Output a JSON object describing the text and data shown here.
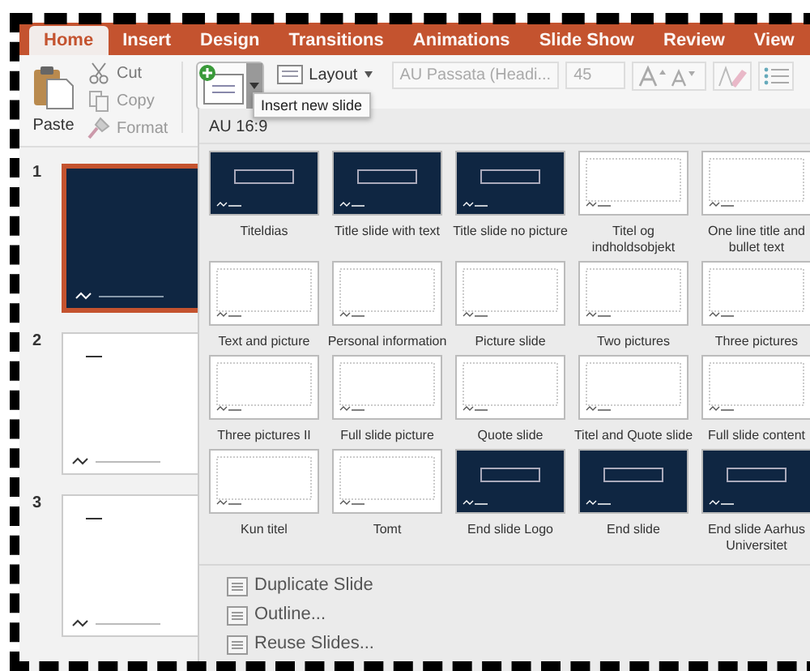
{
  "ribbon": {
    "tabs": [
      {
        "label": "Home",
        "selected": true
      },
      {
        "label": "Insert",
        "selected": false
      },
      {
        "label": "Design",
        "selected": false
      },
      {
        "label": "Transitions",
        "selected": false
      },
      {
        "label": "Animations",
        "selected": false
      },
      {
        "label": "Slide Show",
        "selected": false
      },
      {
        "label": "Review",
        "selected": false
      },
      {
        "label": "View",
        "selected": false
      }
    ],
    "paste": "Paste",
    "cut": "Cut",
    "copy": "Copy",
    "format": "Format",
    "layout": "Layout",
    "font": "AU Passata (Headi...",
    "size": "45"
  },
  "tooltip": "Insert new slide",
  "slides": [
    {
      "number": "1",
      "selected": true,
      "kind": "dark"
    },
    {
      "number": "2",
      "selected": false,
      "kind": "light"
    },
    {
      "number": "3",
      "selected": false,
      "kind": "light"
    }
  ],
  "gallery": {
    "title": "AU 16:9",
    "layouts": [
      {
        "name": "Titeldias",
        "kind": "dark"
      },
      {
        "name": "Title slide with text",
        "kind": "dark"
      },
      {
        "name": "Title slide no picture",
        "kind": "dark"
      },
      {
        "name": "Titel og indholdsobjekt",
        "kind": "light"
      },
      {
        "name": "One line title and bullet text",
        "kind": "light"
      },
      {
        "name": "Text and picture",
        "kind": "light"
      },
      {
        "name": "Personal information",
        "kind": "light"
      },
      {
        "name": "Picture slide",
        "kind": "light"
      },
      {
        "name": "Two pictures",
        "kind": "light"
      },
      {
        "name": "Three pictures",
        "kind": "light"
      },
      {
        "name": "Three pictures II",
        "kind": "light"
      },
      {
        "name": "Full slide picture",
        "kind": "light"
      },
      {
        "name": "Quote slide",
        "kind": "light"
      },
      {
        "name": "Titel and Quote slide",
        "kind": "light"
      },
      {
        "name": "Full slide content",
        "kind": "light"
      },
      {
        "name": "Kun titel",
        "kind": "light"
      },
      {
        "name": "Tomt",
        "kind": "light"
      },
      {
        "name": "End slide Logo",
        "kind": "dark"
      },
      {
        "name": "End slide",
        "kind": "dark"
      },
      {
        "name": "End slide Aarhus Universitet",
        "kind": "dark"
      }
    ],
    "commands": [
      {
        "label": "Duplicate Slide"
      },
      {
        "label": "Outline..."
      },
      {
        "label": "Reuse Slides..."
      }
    ]
  }
}
